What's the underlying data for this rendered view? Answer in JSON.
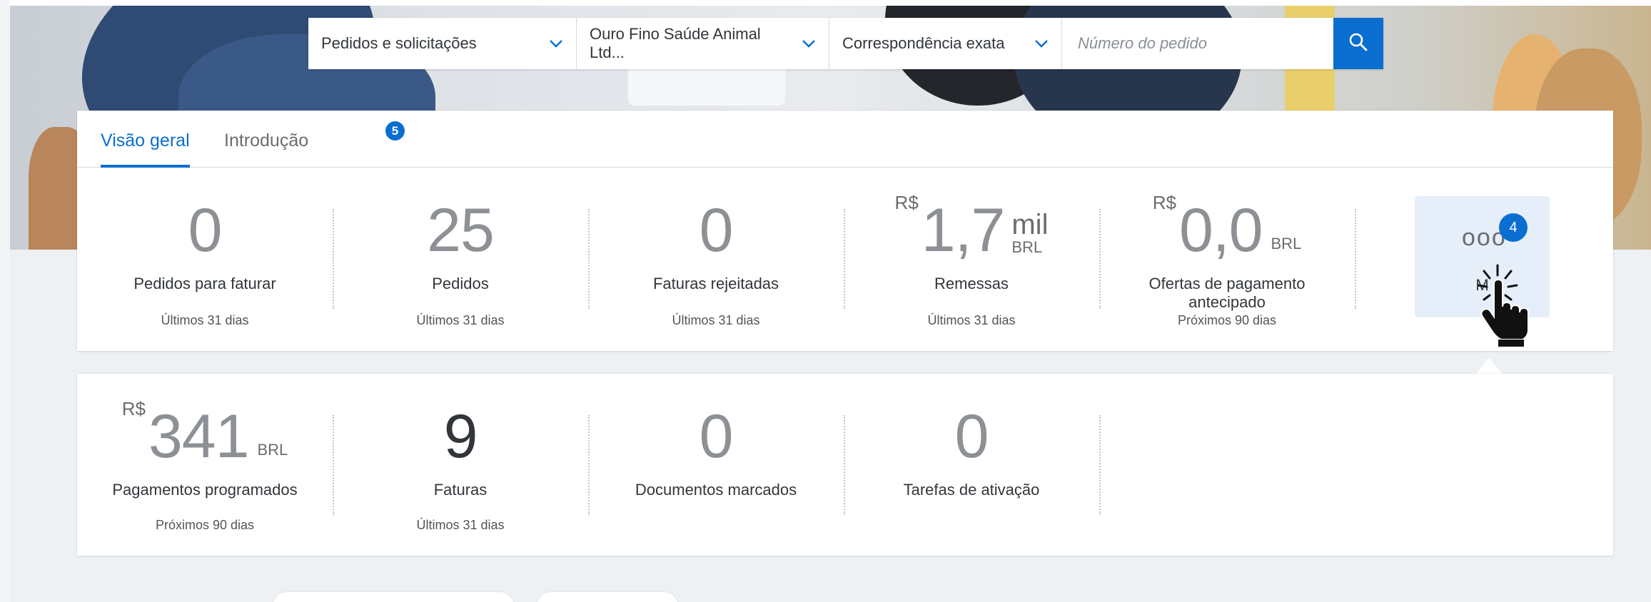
{
  "search": {
    "scope": "Pedidos e solicitações",
    "customer": "Ouro Fino Saúde Animal Ltd...",
    "match": "Correspondência exata",
    "placeholder": "Número do pedido"
  },
  "tabs": [
    {
      "label": "Visão geral",
      "active": true
    },
    {
      "label": "Introdução",
      "badge": "5",
      "active": false
    }
  ],
  "overview": [
    {
      "value": "0",
      "label": "Pedidos para faturar",
      "period": "Últimos 31 dias"
    },
    {
      "value": "25",
      "label": "Pedidos",
      "period": "Últimos 31 dias"
    },
    {
      "value": "0",
      "label": "Faturas rejeitadas",
      "period": "Últimos 31 dias"
    },
    {
      "currency": "R$",
      "value": "1,7",
      "scale": "mil",
      "unit": "BRL",
      "label": "Remessas",
      "period": "Últimos 31 dias"
    },
    {
      "currency": "R$",
      "value": "0,0",
      "unit": "BRL",
      "label": "Ofertas de pagamento antecipado",
      "period": "Próximos 90 dias"
    }
  ],
  "more": {
    "dots": "ooo",
    "badge": "4",
    "label": "M"
  },
  "details": [
    {
      "currency": "R$",
      "value": "341",
      "unit": "BRL",
      "label": "Pagamentos programados",
      "period": "Próximos 90 dias"
    },
    {
      "value": "9",
      "label": "Faturas",
      "period": "Últimos 31 dias"
    },
    {
      "value": "0",
      "label": "Documentos marcados"
    },
    {
      "value": "0",
      "label": "Tarefas de ativação"
    }
  ],
  "colors": {
    "accent": "#0a6ed1",
    "text": "#32363a",
    "muted": "#8d9094",
    "page": "#eef1f4"
  }
}
